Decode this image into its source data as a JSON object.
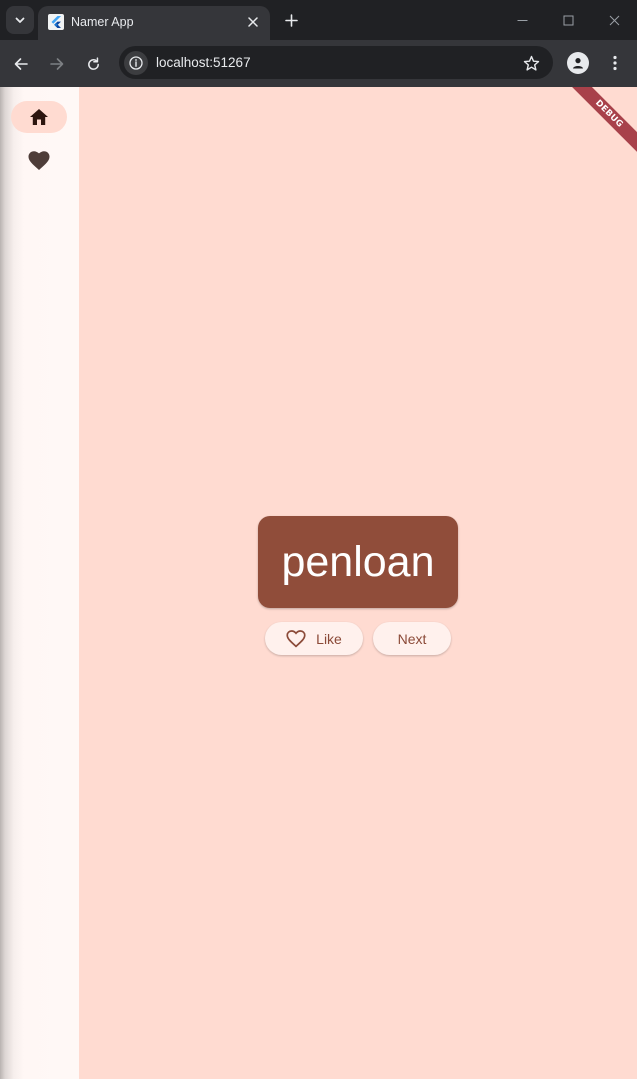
{
  "browser": {
    "tab": {
      "title": "Namer App"
    },
    "address_bar": {
      "url": "localhost:51267"
    }
  },
  "app": {
    "navigation_rail": {
      "items": [
        {
          "id": "home",
          "icon": "home-icon",
          "selected": true
        },
        {
          "id": "favorites",
          "icon": "heart-icon",
          "selected": false
        }
      ]
    },
    "current_pair": "penloan",
    "buttons": {
      "like_label": "Like",
      "next_label": "Next"
    },
    "debug_banner": "DEBUG"
  },
  "colors": {
    "background": "#ffdbd1",
    "rail_background": "#fff8f6",
    "card": "#904d3a",
    "button_background": "#fff1ed",
    "button_text": "#8b4a38",
    "debug_banner": "#a8414a"
  }
}
